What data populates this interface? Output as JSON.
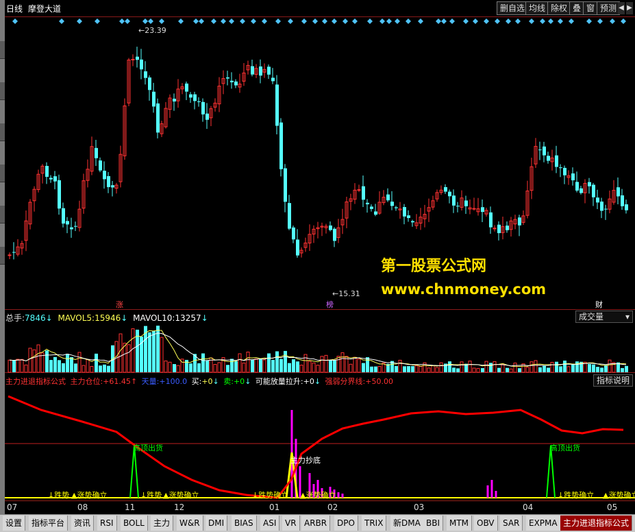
{
  "title_bar": {
    "period": "日线",
    "stock_name": "摩登大道",
    "buttons": [
      "删自选",
      "均线",
      "除权",
      "叠",
      "窗",
      "预测"
    ]
  },
  "price_panel": {
    "high_label": "23.39",
    "low_label": "15.31",
    "event_tags": [
      "涨",
      "榜",
      "财"
    ]
  },
  "watermark": {
    "line1": "第一股票公式网",
    "line2": "www.chnmoney.com"
  },
  "volume_panel": {
    "total_label": "总手:",
    "total_value": "7846",
    "total_arrow": "↓",
    "mavol5_label": "MAVOL5:",
    "mavol5_value": "15946",
    "mavol5_arrow": "↓",
    "mavol10_label": "MAVOL10:",
    "mavol10_value": "13257",
    "mavol10_arrow": "↓",
    "indicator_select": "成交量"
  },
  "indicator_panel": {
    "name": "主力进退指标公式",
    "position_label": "主力仓位:",
    "position_value": "+61.45",
    "position_arrow": "↑",
    "sky_label": "天量:",
    "sky_value": "+100.0",
    "buy_label": "买:",
    "buy_value": "+0",
    "buy_arrow": "↓",
    "sell_label": "卖:",
    "sell_value": "+0",
    "sell_arrow": "↓",
    "surge_label": "可能放量拉升:",
    "surge_value": "+0",
    "surge_arrow": "↓",
    "strong_label": "强弱分界线:",
    "strong_value": "+50.00",
    "help_button": "指标说明",
    "signals": {
      "top_exit": "高顶出货",
      "bottom_buy": "主力抄底",
      "trend_confirm": "涨势确立",
      "fall_confirm": "↓跌势确立",
      "fall_confirm_short": "↓跌势"
    }
  },
  "date_axis": [
    "07",
    "08",
    "11",
    "12",
    "01",
    "02",
    "03",
    "04",
    "05"
  ],
  "bottom_tabs": [
    "设置",
    "指标平台",
    "资讯",
    "RSI",
    "BOLL",
    "主力",
    "W&R",
    "DMI",
    "BIAS",
    "ASI",
    "VR",
    "ARBR",
    "DPO",
    "TRIX",
    "新DMA",
    "BBI",
    "MTM",
    "OBV",
    "SAR",
    "EXPMA",
    "主力进退指标公式"
  ],
  "active_tab": "主力进退指标公式",
  "colors": {
    "up": "#ff3232",
    "down": "#54ffff",
    "background": "#000000",
    "indicator_line": "#ff0000",
    "signal_green": "#00ff00",
    "signal_yellow": "#ffff00",
    "signal_magenta": "#ff00ff",
    "watermark": "#ffe000"
  }
}
